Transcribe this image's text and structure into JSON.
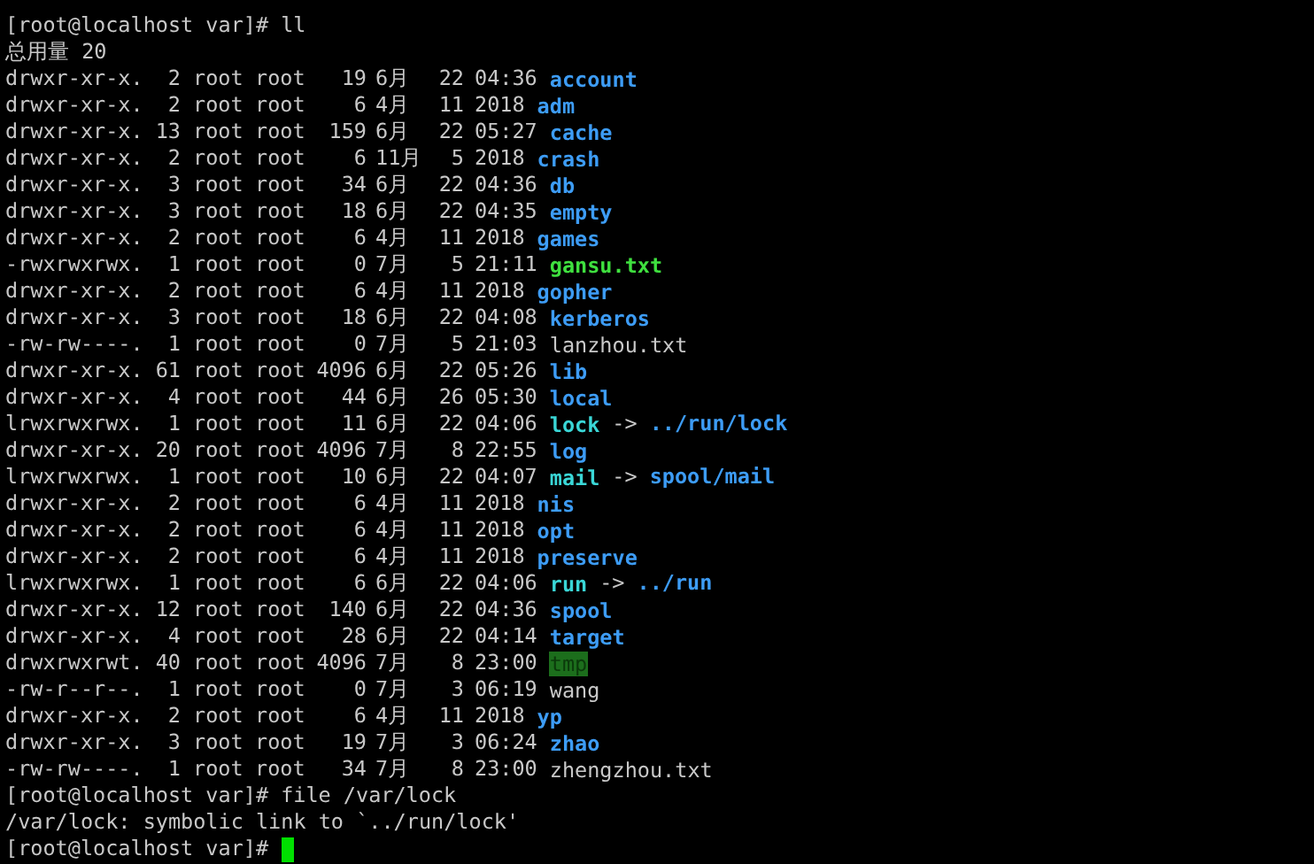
{
  "terminal": {
    "lines": [
      {
        "kind": "prompt",
        "prompt": "[root@localhost var]#",
        "command": "ll"
      },
      {
        "kind": "text",
        "text": "总用量 20"
      },
      {
        "kind": "entry",
        "perms": "drwxr-xr-x.",
        "links": "2",
        "owner": "root",
        "group": "root",
        "size": "19",
        "month": "6月",
        "day": "22",
        "time": "04:36",
        "name": {
          "text": "account",
          "kind": "dir"
        }
      },
      {
        "kind": "entry",
        "perms": "drwxr-xr-x.",
        "links": "2",
        "owner": "root",
        "group": "root",
        "size": "6",
        "month": "4月",
        "day": "11",
        "time": "2018",
        "name": {
          "text": "adm",
          "kind": "dir"
        }
      },
      {
        "kind": "entry",
        "perms": "drwxr-xr-x.",
        "links": "13",
        "owner": "root",
        "group": "root",
        "size": "159",
        "month": "6月",
        "day": "22",
        "time": "05:27",
        "name": {
          "text": "cache",
          "kind": "dir"
        }
      },
      {
        "kind": "entry",
        "perms": "drwxr-xr-x.",
        "links": "2",
        "owner": "root",
        "group": "root",
        "size": "6",
        "month": "11月",
        "day": "5",
        "time": "2018",
        "name": {
          "text": "crash",
          "kind": "dir"
        }
      },
      {
        "kind": "entry",
        "perms": "drwxr-xr-x.",
        "links": "3",
        "owner": "root",
        "group": "root",
        "size": "34",
        "month": "6月",
        "day": "22",
        "time": "04:36",
        "name": {
          "text": "db",
          "kind": "dir"
        }
      },
      {
        "kind": "entry",
        "perms": "drwxr-xr-x.",
        "links": "3",
        "owner": "root",
        "group": "root",
        "size": "18",
        "month": "6月",
        "day": "22",
        "time": "04:35",
        "name": {
          "text": "empty",
          "kind": "dir"
        }
      },
      {
        "kind": "entry",
        "perms": "drwxr-xr-x.",
        "links": "2",
        "owner": "root",
        "group": "root",
        "size": "6",
        "month": "4月",
        "day": "11",
        "time": "2018",
        "name": {
          "text": "games",
          "kind": "dir"
        }
      },
      {
        "kind": "entry",
        "perms": "-rwxrwxrwx.",
        "links": "1",
        "owner": "root",
        "group": "root",
        "size": "0",
        "month": "7月",
        "day": "5",
        "time": "21:11",
        "name": {
          "text": "gansu.txt",
          "kind": "exec"
        }
      },
      {
        "kind": "entry",
        "perms": "drwxr-xr-x.",
        "links": "2",
        "owner": "root",
        "group": "root",
        "size": "6",
        "month": "4月",
        "day": "11",
        "time": "2018",
        "name": {
          "text": "gopher",
          "kind": "dir"
        }
      },
      {
        "kind": "entry",
        "perms": "drwxr-xr-x.",
        "links": "3",
        "owner": "root",
        "group": "root",
        "size": "18",
        "month": "6月",
        "day": "22",
        "time": "04:08",
        "name": {
          "text": "kerberos",
          "kind": "dir"
        }
      },
      {
        "kind": "entry",
        "perms": "-rw-rw----.",
        "links": "1",
        "owner": "root",
        "group": "root",
        "size": "0",
        "month": "7月",
        "day": "5",
        "time": "21:03",
        "name": {
          "text": "lanzhou.txt",
          "kind": "file"
        }
      },
      {
        "kind": "entry",
        "perms": "drwxr-xr-x.",
        "links": "61",
        "owner": "root",
        "group": "root",
        "size": "4096",
        "month": "6月",
        "day": "22",
        "time": "05:26",
        "name": {
          "text": "lib",
          "kind": "dir"
        }
      },
      {
        "kind": "entry",
        "perms": "drwxr-xr-x.",
        "links": "4",
        "owner": "root",
        "group": "root",
        "size": "44",
        "month": "6月",
        "day": "26",
        "time": "05:30",
        "name": {
          "text": "local",
          "kind": "dir"
        }
      },
      {
        "kind": "entry",
        "perms": "lrwxrwxrwx.",
        "links": "1",
        "owner": "root",
        "group": "root",
        "size": "11",
        "month": "6月",
        "day": "22",
        "time": "04:06",
        "name": {
          "text": "lock",
          "kind": "link"
        },
        "arrow": "->",
        "target": {
          "text": "../run/lock",
          "kind": "dir"
        }
      },
      {
        "kind": "entry",
        "perms": "drwxr-xr-x.",
        "links": "20",
        "owner": "root",
        "group": "root",
        "size": "4096",
        "month": "7月",
        "day": "8",
        "time": "22:55",
        "name": {
          "text": "log",
          "kind": "dir"
        }
      },
      {
        "kind": "entry",
        "perms": "lrwxrwxrwx.",
        "links": "1",
        "owner": "root",
        "group": "root",
        "size": "10",
        "month": "6月",
        "day": "22",
        "time": "04:07",
        "name": {
          "text": "mail",
          "kind": "link"
        },
        "arrow": "->",
        "target": {
          "text": "spool/mail",
          "kind": "dir"
        }
      },
      {
        "kind": "entry",
        "perms": "drwxr-xr-x.",
        "links": "2",
        "owner": "root",
        "group": "root",
        "size": "6",
        "month": "4月",
        "day": "11",
        "time": "2018",
        "name": {
          "text": "nis",
          "kind": "dir"
        }
      },
      {
        "kind": "entry",
        "perms": "drwxr-xr-x.",
        "links": "2",
        "owner": "root",
        "group": "root",
        "size": "6",
        "month": "4月",
        "day": "11",
        "time": "2018",
        "name": {
          "text": "opt",
          "kind": "dir"
        }
      },
      {
        "kind": "entry",
        "perms": "drwxr-xr-x.",
        "links": "2",
        "owner": "root",
        "group": "root",
        "size": "6",
        "month": "4月",
        "day": "11",
        "time": "2018",
        "name": {
          "text": "preserve",
          "kind": "dir"
        }
      },
      {
        "kind": "entry",
        "perms": "lrwxrwxrwx.",
        "links": "1",
        "owner": "root",
        "group": "root",
        "size": "6",
        "month": "6月",
        "day": "22",
        "time": "04:06",
        "name": {
          "text": "run",
          "kind": "link"
        },
        "arrow": "->",
        "target": {
          "text": "../run",
          "kind": "dir"
        }
      },
      {
        "kind": "entry",
        "perms": "drwxr-xr-x.",
        "links": "12",
        "owner": "root",
        "group": "root",
        "size": "140",
        "month": "6月",
        "day": "22",
        "time": "04:36",
        "name": {
          "text": "spool",
          "kind": "dir"
        }
      },
      {
        "kind": "entry",
        "perms": "drwxr-xr-x.",
        "links": "4",
        "owner": "root",
        "group": "root",
        "size": "28",
        "month": "6月",
        "day": "22",
        "time": "04:14",
        "name": {
          "text": "target",
          "kind": "dir"
        }
      },
      {
        "kind": "entry",
        "perms": "drwxrwxrwt.",
        "links": "40",
        "owner": "root",
        "group": "root",
        "size": "4096",
        "month": "7月",
        "day": "8",
        "time": "23:00",
        "name": {
          "text": "tmp",
          "kind": "sticky"
        }
      },
      {
        "kind": "entry",
        "perms": "-rw-r--r--.",
        "links": "1",
        "owner": "root",
        "group": "root",
        "size": "0",
        "month": "7月",
        "day": "3",
        "time": "06:19",
        "name": {
          "text": "wang",
          "kind": "file"
        }
      },
      {
        "kind": "entry",
        "perms": "drwxr-xr-x.",
        "links": "2",
        "owner": "root",
        "group": "root",
        "size": "6",
        "month": "4月",
        "day": "11",
        "time": "2018",
        "name": {
          "text": "yp",
          "kind": "dir"
        }
      },
      {
        "kind": "entry",
        "perms": "drwxr-xr-x.",
        "links": "3",
        "owner": "root",
        "group": "root",
        "size": "19",
        "month": "7月",
        "day": "3",
        "time": "06:24",
        "name": {
          "text": "zhao",
          "kind": "dir"
        }
      },
      {
        "kind": "entry",
        "perms": "-rw-rw----.",
        "links": "1",
        "owner": "root",
        "group": "root",
        "size": "34",
        "month": "7月",
        "day": "8",
        "time": "23:00",
        "name": {
          "text": "zhengzhou.txt",
          "kind": "file"
        }
      },
      {
        "kind": "prompt",
        "prompt": "[root@localhost var]#",
        "command": "file /var/lock"
      },
      {
        "kind": "text",
        "text": "/var/lock: symbolic link to `../run/lock'"
      },
      {
        "kind": "prompt",
        "prompt": "[root@localhost var]#",
        "cursor": true
      }
    ]
  }
}
